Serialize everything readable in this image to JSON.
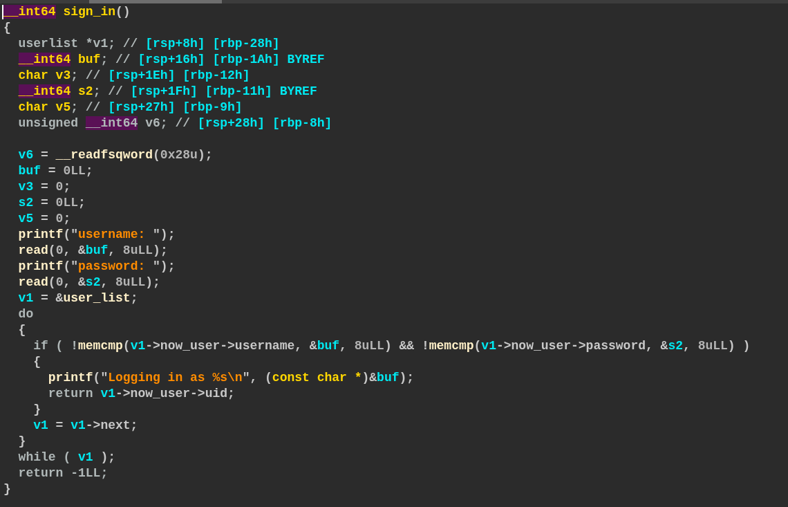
{
  "scrollbar": {
    "kind": "horizontal"
  },
  "cursor": {
    "visible": true
  },
  "lines": [
    {
      "kind": "code",
      "tokens": [
        {
          "text": "__int64",
          "kind": "h"
        },
        {
          "text": " sign_in",
          "kind": "t"
        },
        {
          "text": "()",
          "kind": "p"
        }
      ]
    },
    {
      "kind": "code",
      "tokens": [
        {
          "text": "{",
          "kind": "p"
        }
      ],
      "children": [
        {
          "kind": "code",
          "tokens": [
            {
              "text": "userlist *v1; // ",
              "kind": "d"
            },
            {
              "text": "[rsp+8h] [rbp-28h]",
              "kind": "c"
            }
          ]
        },
        {
          "kind": "code",
          "tokens": [
            {
              "text": "__int64",
              "kind": "h"
            },
            {
              "text": " buf",
              "kind": "t"
            },
            {
              "text": "; // ",
              "kind": "d"
            },
            {
              "text": "[rsp+16h] [rbp-1Ah] BYREF",
              "kind": "c"
            }
          ]
        },
        {
          "kind": "code",
          "tokens": [
            {
              "text": "char v3",
              "kind": "t"
            },
            {
              "text": "; // ",
              "kind": "d"
            },
            {
              "text": "[rsp+1Eh] [rbp-12h]",
              "kind": "c"
            }
          ]
        },
        {
          "kind": "code",
          "tokens": [
            {
              "text": "__int64",
              "kind": "h"
            },
            {
              "text": " s2",
              "kind": "t"
            },
            {
              "text": "; // ",
              "kind": "d"
            },
            {
              "text": "[rsp+1Fh] [rbp-11h] BYREF",
              "kind": "c"
            }
          ]
        },
        {
          "kind": "code",
          "tokens": [
            {
              "text": "char v5",
              "kind": "t"
            },
            {
              "text": "; // ",
              "kind": "d"
            },
            {
              "text": "[rsp+27h] [rbp-9h]",
              "kind": "c"
            }
          ]
        },
        {
          "kind": "code",
          "tokens": [
            {
              "text": "unsigned ",
              "kind": "d"
            },
            {
              "text": "__int64",
              "kind": "g"
            },
            {
              "text": " v6; // ",
              "kind": "d"
            },
            {
              "text": "[rsp+28h] [rbp-8h]",
              "kind": "c"
            }
          ]
        },
        {
          "kind": "blank"
        },
        {
          "kind": "code",
          "tokens": [
            {
              "text": "v6",
              "kind": "v"
            },
            {
              "text": " = ",
              "kind": "p"
            },
            {
              "text": "__readfsqword",
              "kind": "f"
            },
            {
              "text": "(",
              "kind": "p"
            },
            {
              "text": "0x28u",
              "kind": "n"
            },
            {
              "text": ");",
              "kind": "p"
            }
          ]
        },
        {
          "kind": "code",
          "tokens": [
            {
              "text": "buf",
              "kind": "v"
            },
            {
              "text": " = ",
              "kind": "p"
            },
            {
              "text": "0LL",
              "kind": "n"
            },
            {
              "text": ";",
              "kind": "p"
            }
          ]
        },
        {
          "kind": "code",
          "tokens": [
            {
              "text": "v3",
              "kind": "v"
            },
            {
              "text": " = ",
              "kind": "p"
            },
            {
              "text": "0",
              "kind": "n"
            },
            {
              "text": ";",
              "kind": "p"
            }
          ]
        },
        {
          "kind": "code",
          "tokens": [
            {
              "text": "s2",
              "kind": "v"
            },
            {
              "text": " = ",
              "kind": "p"
            },
            {
              "text": "0LL",
              "kind": "n"
            },
            {
              "text": ";",
              "kind": "p"
            }
          ]
        },
        {
          "kind": "code",
          "tokens": [
            {
              "text": "v5",
              "kind": "v"
            },
            {
              "text": " = ",
              "kind": "p"
            },
            {
              "text": "0",
              "kind": "n"
            },
            {
              "text": ";",
              "kind": "p"
            }
          ]
        },
        {
          "kind": "code",
          "tokens": [
            {
              "text": "printf",
              "kind": "f"
            },
            {
              "text": "(\"",
              "kind": "p"
            },
            {
              "text": "username: ",
              "kind": "s"
            },
            {
              "text": "\");",
              "kind": "p"
            }
          ]
        },
        {
          "kind": "code",
          "tokens": [
            {
              "text": "read",
              "kind": "f"
            },
            {
              "text": "(",
              "kind": "p"
            },
            {
              "text": "0",
              "kind": "n"
            },
            {
              "text": ", &",
              "kind": "p"
            },
            {
              "text": "buf",
              "kind": "v"
            },
            {
              "text": ", ",
              "kind": "p"
            },
            {
              "text": "8uLL",
              "kind": "n"
            },
            {
              "text": ");",
              "kind": "p"
            }
          ]
        },
        {
          "kind": "code",
          "tokens": [
            {
              "text": "printf",
              "kind": "f"
            },
            {
              "text": "(\"",
              "kind": "p"
            },
            {
              "text": "password: ",
              "kind": "s"
            },
            {
              "text": "\");",
              "kind": "p"
            }
          ]
        },
        {
          "kind": "code",
          "tokens": [
            {
              "text": "read",
              "kind": "f"
            },
            {
              "text": "(",
              "kind": "p"
            },
            {
              "text": "0",
              "kind": "n"
            },
            {
              "text": ", &",
              "kind": "p"
            },
            {
              "text": "s2",
              "kind": "v"
            },
            {
              "text": ", ",
              "kind": "p"
            },
            {
              "text": "8uLL",
              "kind": "n"
            },
            {
              "text": ");",
              "kind": "p"
            }
          ]
        },
        {
          "kind": "code",
          "tokens": [
            {
              "text": "v1",
              "kind": "v"
            },
            {
              "text": " = &",
              "kind": "p"
            },
            {
              "text": "user_list",
              "kind": "f"
            },
            {
              "text": ";",
              "kind": "p"
            }
          ]
        },
        {
          "kind": "code",
          "tokens": [
            {
              "text": "do",
              "kind": "d"
            }
          ]
        },
        {
          "kind": "code",
          "tokens": [
            {
              "text": "{",
              "kind": "p"
            }
          ],
          "children": [
            {
              "kind": "code",
              "tokens": [
                {
                  "text": "if ( !",
                  "kind": "d"
                },
                {
                  "text": "memcmp",
                  "kind": "f"
                },
                {
                  "text": "(",
                  "kind": "p"
                },
                {
                  "text": "v1",
                  "kind": "v"
                },
                {
                  "text": "->now_user->username, &",
                  "kind": "p"
                },
                {
                  "text": "buf",
                  "kind": "v"
                },
                {
                  "text": ", ",
                  "kind": "p"
                },
                {
                  "text": "8uLL",
                  "kind": "n"
                },
                {
                  "text": ") && !",
                  "kind": "p"
                },
                {
                  "text": "memcmp",
                  "kind": "f"
                },
                {
                  "text": "(",
                  "kind": "p"
                },
                {
                  "text": "v1",
                  "kind": "v"
                },
                {
                  "text": "->now_user->password, &",
                  "kind": "p"
                },
                {
                  "text": "s2",
                  "kind": "v"
                },
                {
                  "text": ", ",
                  "kind": "p"
                },
                {
                  "text": "8uLL",
                  "kind": "n"
                },
                {
                  "text": ") )",
                  "kind": "p"
                }
              ]
            },
            {
              "kind": "code",
              "tokens": [
                {
                  "text": "{",
                  "kind": "p"
                }
              ],
              "children": [
                {
                  "kind": "code",
                  "tokens": [
                    {
                      "text": "printf",
                      "kind": "f"
                    },
                    {
                      "text": "(\"",
                      "kind": "p"
                    },
                    {
                      "text": "Logging in as %s\\n",
                      "kind": "s"
                    },
                    {
                      "text": "\", (",
                      "kind": "p"
                    },
                    {
                      "text": "const char *",
                      "kind": "t"
                    },
                    {
                      "text": ")&",
                      "kind": "p"
                    },
                    {
                      "text": "buf",
                      "kind": "v"
                    },
                    {
                      "text": ");",
                      "kind": "p"
                    }
                  ]
                },
                {
                  "kind": "code",
                  "tokens": [
                    {
                      "text": "return ",
                      "kind": "d"
                    },
                    {
                      "text": "v1",
                      "kind": "v"
                    },
                    {
                      "text": "->now_user->uid;",
                      "kind": "p"
                    }
                  ]
                }
              ]
            },
            {
              "kind": "code",
              "tokens": [
                {
                  "text": "}",
                  "kind": "p"
                }
              ]
            },
            {
              "kind": "code",
              "tokens": [
                {
                  "text": "v1",
                  "kind": "v"
                },
                {
                  "text": " = ",
                  "kind": "p"
                },
                {
                  "text": "v1",
                  "kind": "v"
                },
                {
                  "text": "->next;",
                  "kind": "p"
                }
              ]
            }
          ]
        },
        {
          "kind": "code",
          "tokens": [
            {
              "text": "}",
              "kind": "p"
            }
          ]
        },
        {
          "kind": "code",
          "tokens": [
            {
              "text": "while ( ",
              "kind": "d"
            },
            {
              "text": "v1",
              "kind": "v"
            },
            {
              "text": " );",
              "kind": "p"
            }
          ]
        },
        {
          "kind": "code",
          "tokens": [
            {
              "text": "return -1LL;",
              "kind": "d"
            }
          ]
        }
      ]
    },
    {
      "kind": "code",
      "tokens": [
        {
          "text": "}",
          "kind": "p"
        }
      ]
    }
  ]
}
